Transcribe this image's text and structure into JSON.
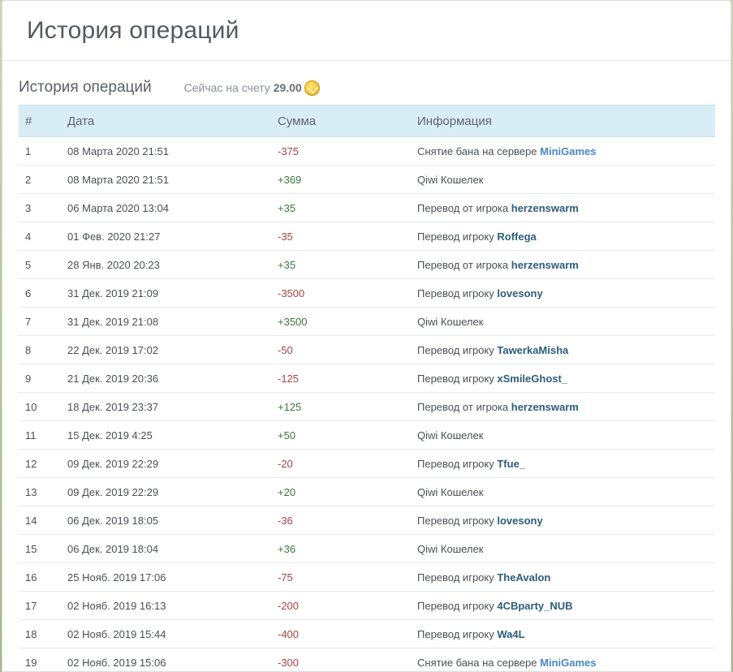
{
  "page": {
    "title": "История операций"
  },
  "section": {
    "title": "История операций",
    "balance_label": "Сейчас на счету",
    "balance_value": "29.00",
    "balance_icon": "coin-icon"
  },
  "table": {
    "headers": [
      "#",
      "Дата",
      "Сумма",
      "Информация"
    ],
    "rows": [
      {
        "num": "1",
        "date": "08 Марта 2020 21:51",
        "sum": "-375",
        "sign": "neg",
        "info": "Снятие бана на сервере",
        "target": "MiniGames",
        "target_type": "server"
      },
      {
        "num": "2",
        "date": "08 Марта 2020 21:51",
        "sum": "+369",
        "sign": "pos",
        "info": "Qiwi Кошелек",
        "target": "",
        "target_type": ""
      },
      {
        "num": "3",
        "date": "06 Марта 2020 13:04",
        "sum": "+35",
        "sign": "pos",
        "info": "Перевод от игрока",
        "target": "herzenswarm",
        "target_type": "player"
      },
      {
        "num": "4",
        "date": "01 Фев. 2020 21:27",
        "sum": "-35",
        "sign": "neg",
        "info": "Перевод игроку",
        "target": "Roffega",
        "target_type": "player"
      },
      {
        "num": "5",
        "date": "28 Янв. 2020 20:23",
        "sum": "+35",
        "sign": "pos",
        "info": "Перевод от игрока",
        "target": "herzenswarm",
        "target_type": "player"
      },
      {
        "num": "6",
        "date": "31 Дек. 2019 21:09",
        "sum": "-3500",
        "sign": "neg",
        "info": "Перевод игроку",
        "target": "lovesony",
        "target_type": "player"
      },
      {
        "num": "7",
        "date": "31 Дек. 2019 21:08",
        "sum": "+3500",
        "sign": "pos",
        "info": "Qiwi Кошелек",
        "target": "",
        "target_type": ""
      },
      {
        "num": "8",
        "date": "22 Дек. 2019 17:02",
        "sum": "-50",
        "sign": "neg",
        "info": "Перевод игроку",
        "target": "TawerkaMisha",
        "target_type": "player"
      },
      {
        "num": "9",
        "date": "21 Дек. 2019 20:36",
        "sum": "-125",
        "sign": "neg",
        "info": "Перевод игроку",
        "target": "xSmileGhost_",
        "target_type": "player"
      },
      {
        "num": "10",
        "date": "18 Дек. 2019 23:37",
        "sum": "+125",
        "sign": "pos",
        "info": "Перевод от игрока",
        "target": "herzenswarm",
        "target_type": "player"
      },
      {
        "num": "11",
        "date": "15 Дек. 2019 4:25",
        "sum": "+50",
        "sign": "pos",
        "info": "Qiwi Кошелек",
        "target": "",
        "target_type": ""
      },
      {
        "num": "12",
        "date": "09 Дек. 2019 22:29",
        "sum": "-20",
        "sign": "neg",
        "info": "Перевод игроку",
        "target": "Tfue_",
        "target_type": "player"
      },
      {
        "num": "13",
        "date": "09 Дек. 2019 22:29",
        "sum": "+20",
        "sign": "pos",
        "info": "Qiwi Кошелек",
        "target": "",
        "target_type": ""
      },
      {
        "num": "14",
        "date": "06 Дек. 2019 18:05",
        "sum": "-36",
        "sign": "neg",
        "info": "Перевод игроку",
        "target": "lovesony",
        "target_type": "player"
      },
      {
        "num": "15",
        "date": "06 Дек. 2019 18:04",
        "sum": "+36",
        "sign": "pos",
        "info": "Qiwi Кошелек",
        "target": "",
        "target_type": ""
      },
      {
        "num": "16",
        "date": "25 Нояб. 2019 17:06",
        "sum": "-75",
        "sign": "neg",
        "info": "Перевод игроку",
        "target": "TheAvalon",
        "target_type": "player"
      },
      {
        "num": "17",
        "date": "02 Нояб. 2019 16:13",
        "sum": "-200",
        "sign": "neg",
        "info": "Перевод игроку",
        "target": "4CBparty_NUB",
        "target_type": "player"
      },
      {
        "num": "18",
        "date": "02 Нояб. 2019 15:44",
        "sum": "-400",
        "sign": "neg",
        "info": "Перевод игроку",
        "target": "Wa4L",
        "target_type": "player"
      },
      {
        "num": "19",
        "date": "02 Нояб. 2019 15:06",
        "sum": "-300",
        "sign": "neg",
        "info": "Снятие бана на сервере",
        "target": "MiniGames",
        "target_type": "server"
      }
    ]
  }
}
